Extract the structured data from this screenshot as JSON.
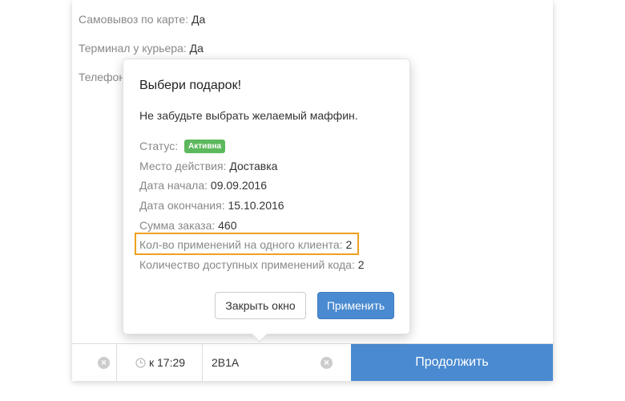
{
  "order_fields": [
    {
      "label": "Самовывоз по карте:",
      "value": "Да"
    },
    {
      "label": "Терминал у курьера:",
      "value": "Да"
    },
    {
      "label": "Телефон",
      "value": ""
    }
  ],
  "bottom_bar": {
    "time_value": "к 17:29",
    "promo_code_value": "2B1A",
    "continue_label": "Продолжить"
  },
  "popover": {
    "title": "Выбери подарок!",
    "description": "Не забудьте выбрать желаемый маффин.",
    "status_label": "Статус:",
    "status_badge": "Активна",
    "status_color": "#5cb85c",
    "fields": [
      {
        "label": "Место действия:",
        "value": "Доставка"
      },
      {
        "label": "Дата начала:",
        "value": "09.09.2016"
      },
      {
        "label": "Дата окончания:",
        "value": "15.10.2016"
      },
      {
        "label": "Сумма заказа:",
        "value": "460"
      },
      {
        "label": "Кол-во применений на одного клиента:",
        "value": "2"
      },
      {
        "label": "Количество доступных применений кода:",
        "value": "2"
      }
    ],
    "highlight_color": "#f0a020",
    "close_button": "Закрыть окно",
    "apply_button": "Применить"
  },
  "accent_color": "#4a8ad0"
}
